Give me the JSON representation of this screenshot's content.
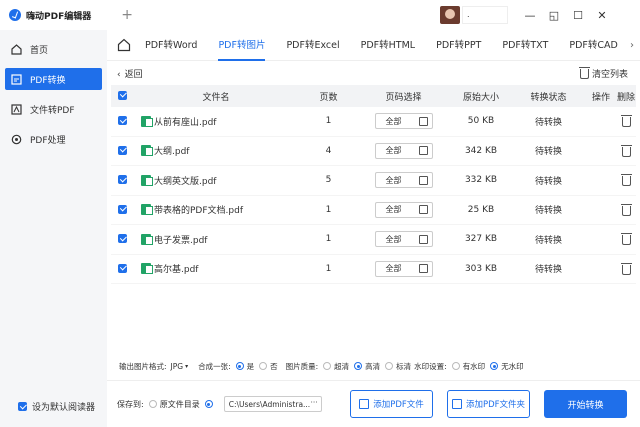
{
  "app": {
    "title": "嗨动PDF编辑器",
    "new_tab": "+",
    "user": "."
  },
  "window": {
    "min": "—",
    "max": "◱",
    "restore": "☐",
    "close": "✕"
  },
  "sidebar": {
    "items": [
      {
        "label": "首页",
        "icon": "home-icon"
      },
      {
        "label": "PDF转换",
        "icon": "convert-icon",
        "active": true
      },
      {
        "label": "文件转PDF",
        "icon": "file-to-pdf-icon"
      },
      {
        "label": "PDF处理",
        "icon": "process-icon"
      }
    ],
    "default_reader": "设为默认阅读器"
  },
  "tabs": [
    "PDF转Word",
    "PDF转图片",
    "PDF转Excel",
    "PDF转HTML",
    "PDF转PPT",
    "PDF转TXT",
    "PDF转CAD"
  ],
  "tab_more": "›",
  "toolbar": {
    "back": "返回",
    "back_arrow": "‹",
    "clear": "清空列表"
  },
  "table": {
    "headers": {
      "name": "文件名",
      "pages": "页数",
      "range": "页码选择",
      "size": "原始大小",
      "status": "转换状态",
      "op": "操作",
      "del": "删除"
    },
    "rows": [
      {
        "name": "从前有座山.pdf",
        "pages": "1",
        "range": "全部",
        "size": "50 KB",
        "status": "待转换"
      },
      {
        "name": "大纲.pdf",
        "pages": "4",
        "range": "全部",
        "size": "342 KB",
        "status": "待转换"
      },
      {
        "name": "大纲英文版.pdf",
        "pages": "5",
        "range": "全部",
        "size": "332 KB",
        "status": "待转换"
      },
      {
        "name": "带表格的PDF文档.pdf",
        "pages": "1",
        "range": "全部",
        "size": "25 KB",
        "status": "待转换"
      },
      {
        "name": "电子发票.pdf",
        "pages": "1",
        "range": "全部",
        "size": "327 KB",
        "status": "待转换"
      },
      {
        "name": "高尔基.pdf",
        "pages": "1",
        "range": "全部",
        "size": "303 KB",
        "status": "待转换"
      }
    ]
  },
  "options": {
    "format_label": "输出图片格式:",
    "format_value": "JPG",
    "merge_label": "合成一张:",
    "merge_yes": "是",
    "merge_no": "否",
    "quality_label": "图片质量:",
    "q_ultra": "超清",
    "q_high": "高清",
    "q_std": "标清",
    "wm_label": "水印设置:",
    "wm_yes": "有水印",
    "wm_no": "无水印"
  },
  "bottom": {
    "save_label": "保存到:",
    "save_original": "原文件目录",
    "path": "C:\\Users\\Administra...",
    "path_more": "···",
    "add_file": "添加PDF文件",
    "add_folder": "添加PDF文件夹",
    "start": "开始转换"
  },
  "colors": {
    "accent": "#1f6fea"
  }
}
